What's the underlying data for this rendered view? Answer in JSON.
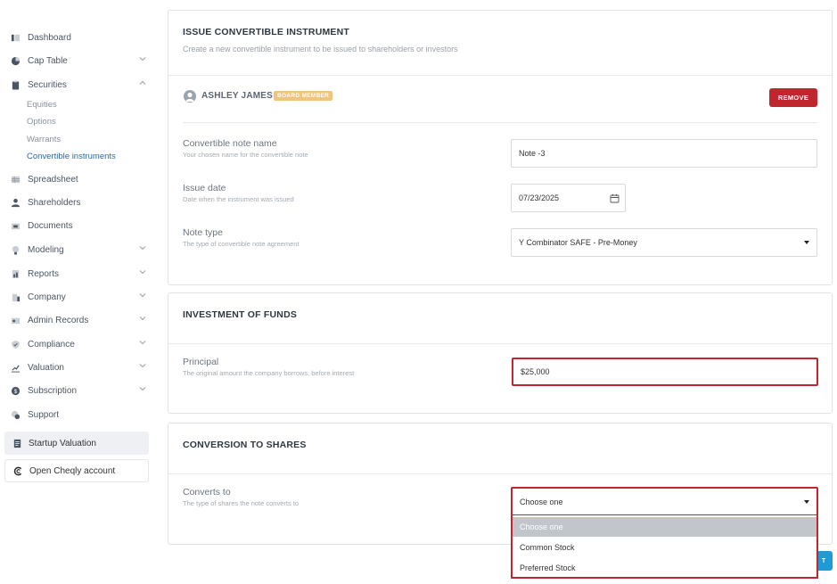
{
  "sidebar": {
    "items": [
      {
        "label": "Dashboard",
        "icon": "dashboard-icon"
      },
      {
        "label": "Cap Table",
        "icon": "pie-chart-icon"
      },
      {
        "label": "Securities",
        "icon": "clipboard-icon"
      },
      {
        "label": "Spreadsheet",
        "icon": "grid-icon"
      },
      {
        "label": "Shareholders",
        "icon": "person-icon"
      },
      {
        "label": "Documents",
        "icon": "folder-icon"
      },
      {
        "label": "Modeling",
        "icon": "lightbulb-icon"
      },
      {
        "label": "Reports",
        "icon": "report-icon"
      },
      {
        "label": "Company",
        "icon": "building-icon"
      },
      {
        "label": "Admin Records",
        "icon": "records-icon"
      },
      {
        "label": "Compliance",
        "icon": "shield-icon"
      },
      {
        "label": "Valuation",
        "icon": "chart-icon"
      },
      {
        "label": "Subscription",
        "icon": "dollar-icon"
      },
      {
        "label": "Support",
        "icon": "support-icon"
      }
    ],
    "securities_sub": [
      "Equities",
      "Options",
      "Warrants",
      "Convertible instruments"
    ],
    "startup_valuation": "Startup Valuation",
    "open_account": "Open Cheqly account"
  },
  "issue": {
    "title": "ISSUE CONVERTIBLE INSTRUMENT",
    "subtitle": "Create a new convertible instrument to be issued to shareholders or investors",
    "person_name": "ASHLEY JAMES",
    "badge": "BOARD MEMBER",
    "remove_label": "REMOVE",
    "name_label": "Convertible note name",
    "name_help": "Your chosen name for the convertible note",
    "name_value": "Note -3",
    "date_label": "Issue date",
    "date_help": "Date when the instrument was issued",
    "date_value": "07/23/2025",
    "type_label": "Note type",
    "type_help": "The type of convertible note agreement",
    "type_value": "Y Combinator SAFE - Pre-Money"
  },
  "investment": {
    "title": "INVESTMENT OF FUNDS",
    "principal_label": "Principal",
    "principal_help": "The original amount the company borrows, before interest",
    "principal_value": "$25,000"
  },
  "conversion": {
    "title": "CONVERSION TO SHARES",
    "converts_label": "Converts to",
    "converts_help": "The type of shares the note converts to",
    "selected": "Choose one",
    "options": [
      "Choose one",
      "Common Stock",
      "Preferred Stock"
    ]
  },
  "submit_partial": "T",
  "colors": {
    "accent": "#2b6aa3",
    "danger": "#c0262d",
    "badge": "#f2c37c",
    "primary_button": "#1e9bd7"
  }
}
